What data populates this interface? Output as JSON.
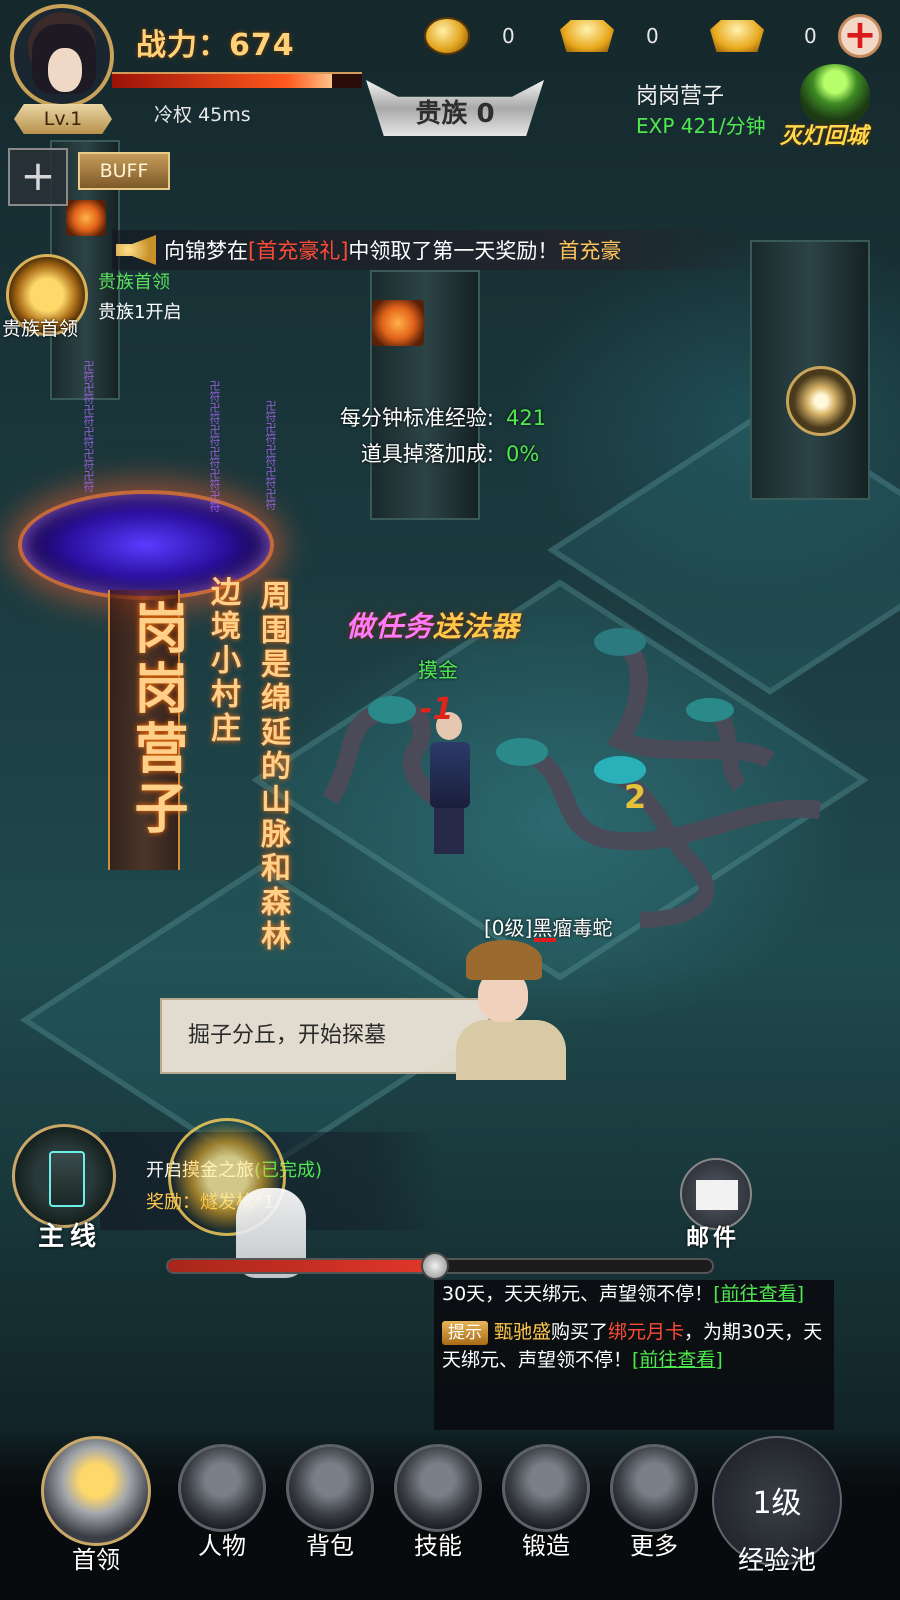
{
  "hud": {
    "level": "Lv.1",
    "power": "战力：674",
    "hp_fraction": 0.88,
    "ping": "冷权 45ms",
    "currencies": [
      {
        "icon": "coin-icon",
        "value": "0"
      },
      {
        "icon": "locked-ingot-icon",
        "value": "0"
      },
      {
        "icon": "ingot-icon",
        "value": "0"
      }
    ],
    "plus": "+",
    "noble": "贵族 0",
    "location": "岗岗营子",
    "exp_rate": "EXP 421/分钟",
    "lamp": "灭灯回城",
    "add_slot": "+",
    "buff": "BUFF"
  },
  "broadcast": {
    "prefix": "向锦梦在",
    "highlight": "[首充豪礼]",
    "middle": "中领取了第一天奖励！",
    "tail": "首充豪"
  },
  "noble_leader": {
    "label": "贵族首领",
    "title": "贵族首领",
    "desc": "贵族1开启"
  },
  "stats": [
    {
      "label": "每分钟标准经验:",
      "value": "421"
    },
    {
      "label": "道具掉落加成:",
      "value": "0%"
    }
  ],
  "zone_banner": {
    "name": "岗岗营子",
    "line1": "边境小村庄",
    "line2": "周围是绵延的山脉和森林"
  },
  "scene": {
    "quest_pink": "做任务",
    "quest_gold": "送法器",
    "player_name": "摸金",
    "damage_a": "-1",
    "damage_b": "2",
    "enemy_name": "[0级]黑瘤毒蛇",
    "dialog": "掘子分丘，开始探墓"
  },
  "main_quest": {
    "label": "主线",
    "title": "开启摸金之旅",
    "status": "(已完成)",
    "reward": "奖励：燧发枪*1",
    "progress_fraction": 0.49
  },
  "mail": {
    "label": "邮件"
  },
  "chat": {
    "line1_a": "30天，天天绑元、声望领不停！",
    "line1_link": "[前往查看]",
    "tag": "提示",
    "line2_name": "甄驰盛",
    "line2_a": "购买了",
    "line2_item": "绑元月卡",
    "line2_b": "，为期30天，天天绑元、声望领不停！",
    "line2_link": "[前往查看]"
  },
  "nav": [
    {
      "label": "首领"
    },
    {
      "label": "人物"
    },
    {
      "label": "背包"
    },
    {
      "label": "技能"
    },
    {
      "label": "锻造"
    },
    {
      "label": "更多"
    }
  ],
  "exp_pool": {
    "value": "1级",
    "label": "经验池"
  }
}
